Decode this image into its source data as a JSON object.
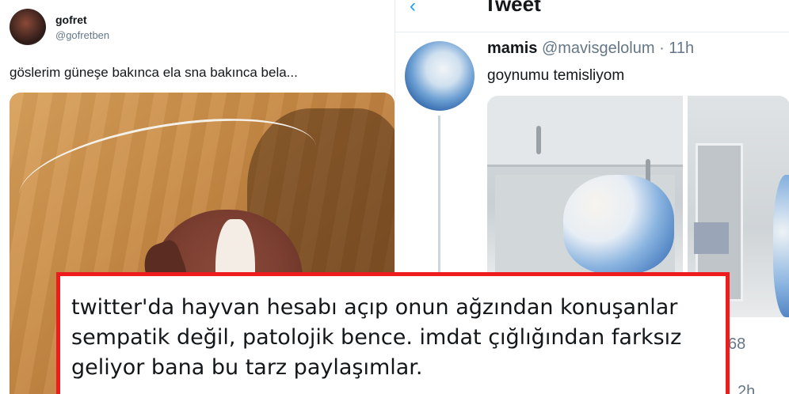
{
  "left_tweet": {
    "display_name": "gofret",
    "handle": "@gofretben",
    "text": "göslerim güneşe bakınca ela sna bakınca bela...",
    "avatar_icon": "puppy-avatar-icon",
    "photo_subject": "puppy-photo"
  },
  "right_tweet": {
    "header_title": "Tweet",
    "back_icon": "back-arrow-icon",
    "display_name": "mamis",
    "handle": "@mavisgelolum",
    "separator": " · ",
    "time": "11h",
    "text": "goynumu temisliyom",
    "reply_count_partial": "68",
    "time_partial": "2h",
    "photos": [
      "budgie-photo-1",
      "budgie-photo-2"
    ]
  },
  "quote_box": {
    "text": "twitter'da hayvan hesabı açıp onun ağzından konuşanlar sempatik değil, patolojik bence. imdat çığlığından farksız geliyor bana bu tarz paylaşımlar.",
    "border_color": "#ee1c1c"
  },
  "colors": {
    "accent": "#1da1f2",
    "muted_text": "#657786",
    "primary_text": "#14171a"
  }
}
